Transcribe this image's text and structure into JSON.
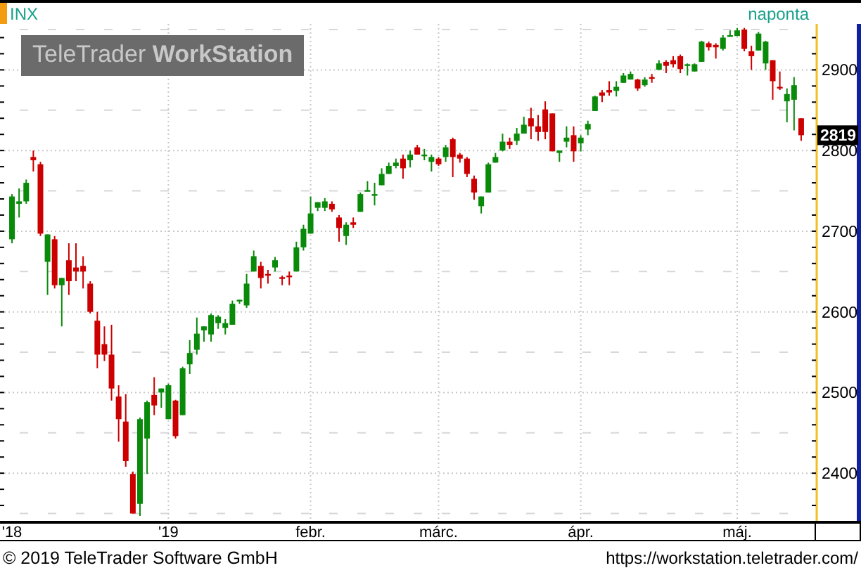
{
  "header": {
    "symbol": "INX",
    "interval": "naponta"
  },
  "logo": "TeleTrader **WorkStation**",
  "chart_data": {
    "type": "candlestick",
    "grid": true,
    "ylim": [
      2340,
      2957
    ],
    "yticks": [
      2400,
      2500,
      2600,
      2700,
      2800,
      2900
    ],
    "categories": [
      "'18",
      null,
      null,
      null,
      null,
      null,
      null,
      null,
      null,
      null,
      null,
      null,
      null,
      null,
      null,
      null,
      null,
      null,
      null,
      null,
      null,
      null,
      "'19",
      null,
      null,
      null,
      null,
      null,
      null,
      null,
      null,
      null,
      null,
      null,
      null,
      null,
      null,
      null,
      null,
      null,
      null,
      null,
      "febr.",
      null,
      null,
      null,
      null,
      null,
      null,
      null,
      null,
      null,
      null,
      null,
      null,
      null,
      null,
      null,
      null,
      null,
      "márc.",
      null,
      null,
      null,
      null,
      null,
      null,
      null,
      null,
      null,
      null,
      null,
      null,
      null,
      null,
      null,
      null,
      null,
      null,
      null,
      "ápr.",
      null,
      null,
      null,
      null,
      null,
      null,
      null,
      null,
      null,
      null,
      null,
      null,
      null,
      null,
      null,
      null,
      null,
      null,
      null,
      null,
      null,
      "máj.",
      null,
      null,
      null,
      null,
      null,
      null,
      null,
      null,
      null
    ],
    "ohlc": [
      [
        2690,
        2746,
        2685,
        2743
      ],
      [
        2734,
        2753,
        2717,
        2737
      ],
      [
        2737,
        2764,
        2734,
        2760
      ],
      [
        2792,
        2800,
        2774,
        2788
      ],
      [
        2783,
        2786,
        2694,
        2697
      ],
      [
        2662,
        2696,
        2621,
        2696
      ],
      [
        2690,
        2694,
        2629,
        2633
      ],
      [
        2633,
        2642,
        2582,
        2642
      ],
      [
        2664,
        2685,
        2621,
        2638
      ],
      [
        2655,
        2685,
        2638,
        2650
      ],
      [
        2657,
        2669,
        2629,
        2650
      ],
      [
        2635,
        2638,
        2598,
        2600
      ],
      [
        2589,
        2600,
        2530,
        2547
      ],
      [
        2560,
        2582,
        2539,
        2547
      ],
      [
        2547,
        2584,
        2490,
        2505
      ],
      [
        2495,
        2509,
        2439,
        2467
      ],
      [
        2464,
        2498,
        2408,
        2415
      ],
      [
        2399,
        2402,
        2350,
        2350
      ],
      [
        2362,
        2469,
        2347,
        2467
      ],
      [
        2443,
        2490,
        2399,
        2488
      ],
      [
        2497,
        2519,
        2472,
        2484
      ],
      [
        2500,
        2505,
        2481,
        2505
      ],
      [
        2467,
        2511,
        2467,
        2509
      ],
      [
        2490,
        2491,
        2443,
        2446
      ],
      [
        2472,
        2532,
        2472,
        2530
      ],
      [
        2535,
        2565,
        2523,
        2549
      ],
      [
        2553,
        2593,
        2547,
        2573
      ],
      [
        2577,
        2582,
        2563,
        2582
      ],
      [
        2572,
        2598,
        2563,
        2596
      ],
      [
        2586,
        2596,
        2579,
        2594
      ],
      [
        2580,
        2591,
        2572,
        2586
      ],
      [
        2584,
        2614,
        2584,
        2610
      ],
      [
        2614,
        2615,
        2610,
        2615
      ],
      [
        2608,
        2647,
        2605,
        2635
      ],
      [
        2650,
        2676,
        2650,
        2669
      ],
      [
        2657,
        2662,
        2629,
        2642
      ],
      [
        2647,
        2652,
        2635,
        2645
      ],
      [
        2655,
        2668,
        2650,
        2664
      ],
      [
        2643,
        2645,
        2633,
        2642
      ],
      [
        2645,
        2650,
        2633,
        2643
      ],
      [
        2650,
        2687,
        2650,
        2680
      ],
      [
        2680,
        2708,
        2676,
        2703
      ],
      [
        2697,
        2743,
        2697,
        2722
      ],
      [
        2729,
        2736,
        2725,
        2736
      ],
      [
        2729,
        2741,
        2725,
        2737
      ],
      [
        2734,
        2737,
        2724,
        2727
      ],
      [
        2717,
        2720,
        2687,
        2704
      ],
      [
        2694,
        2711,
        2683,
        2708
      ],
      [
        2711,
        2717,
        2704,
        2708
      ],
      [
        2724,
        2748,
        2724,
        2746
      ],
      [
        2750,
        2762,
        2750,
        2751
      ],
      [
        2744,
        2760,
        2732,
        2746
      ],
      [
        2757,
        2778,
        2757,
        2771
      ],
      [
        2771,
        2785,
        2771,
        2781
      ],
      [
        2781,
        2790,
        2778,
        2785
      ],
      [
        2790,
        2795,
        2765,
        2778
      ],
      [
        2788,
        2800,
        2779,
        2795
      ],
      [
        2804,
        2807,
        2795,
        2795
      ],
      [
        2793,
        2802,
        2788,
        2795
      ],
      [
        2786,
        2795,
        2774,
        2792
      ],
      [
        2790,
        2792,
        2781,
        2783
      ],
      [
        2792,
        2807,
        2786,
        2804
      ],
      [
        2814,
        2816,
        2767,
        2792
      ],
      [
        2795,
        2797,
        2785,
        2790
      ],
      [
        2790,
        2792,
        2767,
        2771
      ],
      [
        2765,
        2769,
        2739,
        2748
      ],
      [
        2731,
        2743,
        2722,
        2743
      ],
      [
        2748,
        2785,
        2748,
        2783
      ],
      [
        2785,
        2797,
        2785,
        2792
      ],
      [
        2800,
        2821,
        2799,
        2811
      ],
      [
        2811,
        2816,
        2802,
        2807
      ],
      [
        2812,
        2828,
        2807,
        2821
      ],
      [
        2821,
        2842,
        2821,
        2832
      ],
      [
        2840,
        2853,
        2814,
        2830
      ],
      [
        2830,
        2844,
        2812,
        2823
      ],
      [
        2851,
        2861,
        2814,
        2823
      ],
      [
        2846,
        2846,
        2799,
        2799
      ],
      [
        2797,
        2800,
        2786,
        2800
      ],
      [
        2811,
        2830,
        2804,
        2816
      ],
      [
        2819,
        2830,
        2786,
        2799
      ],
      [
        2809,
        2819,
        2799,
        2816
      ],
      [
        2826,
        2837,
        2819,
        2833
      ],
      [
        2849,
        2868,
        2849,
        2867
      ],
      [
        2872,
        2875,
        2860,
        2868
      ],
      [
        2875,
        2886,
        2868,
        2872
      ],
      [
        2874,
        2886,
        2867,
        2879
      ],
      [
        2884,
        2896,
        2884,
        2893
      ],
      [
        2888,
        2898,
        2888,
        2895
      ],
      [
        2888,
        2889,
        2874,
        2877
      ],
      [
        2881,
        2891,
        2879,
        2888
      ],
      [
        2891,
        2895,
        2884,
        2889
      ],
      [
        2900,
        2912,
        2900,
        2908
      ],
      [
        2910,
        2912,
        2896,
        2905
      ],
      [
        2912,
        2917,
        2903,
        2907
      ],
      [
        2917,
        2919,
        2896,
        2901
      ],
      [
        2905,
        2908,
        2893,
        2907
      ],
      [
        2898,
        2908,
        2898,
        2907
      ],
      [
        2910,
        2936,
        2910,
        2935
      ],
      [
        2933,
        2935,
        2924,
        2928
      ],
      [
        2931,
        2933,
        2914,
        2928
      ],
      [
        2926,
        2943,
        2924,
        2940
      ],
      [
        2942,
        2949,
        2942,
        2943
      ],
      [
        2942,
        2952,
        2942,
        2949
      ],
      [
        2950,
        2952,
        2923,
        2926
      ],
      [
        2923,
        2930,
        2900,
        2917
      ],
      [
        2924,
        2947,
        2924,
        2945
      ],
      [
        2908,
        2936,
        2900,
        2935
      ],
      [
        2912,
        2912,
        2863,
        2886
      ],
      [
        2879,
        2898,
        2875,
        2877
      ],
      [
        2861,
        2877,
        2835,
        2870
      ],
      [
        2863,
        2891,
        2825,
        2881
      ],
      [
        2840,
        2840,
        2812,
        2819
      ]
    ]
  },
  "last_price": "2819",
  "footer": {
    "copyright": "© 2019 TeleTrader Software GmbH",
    "url": "https://workstation.teletrader.com/"
  }
}
